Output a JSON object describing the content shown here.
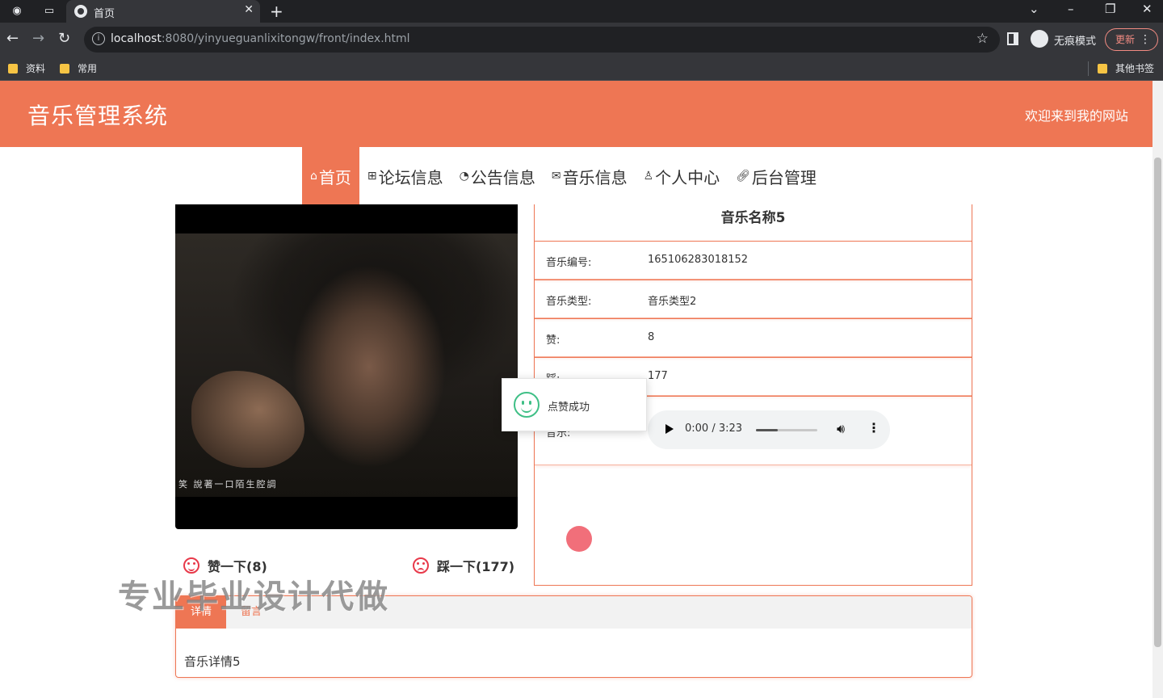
{
  "browser": {
    "tab_title": "首页",
    "url_host": "localhost",
    "url_path": ":8080/yinyueguanlixitongw/front/index.html",
    "profile_label": "无痕模式",
    "update_label": "更新",
    "bookmarks": [
      "资料",
      "常用"
    ],
    "other_bookmarks": "其他书签"
  },
  "header": {
    "title": "音乐管理系统",
    "welcome": "欢迎来到我的网站",
    "accent_color": "#ee7654"
  },
  "nav": {
    "items": [
      {
        "icon": "home-icon",
        "label": "首页"
      },
      {
        "icon": "gift-icon",
        "label": "论坛信息"
      },
      {
        "icon": "gauge-icon",
        "label": "公告信息"
      },
      {
        "icon": "mail-icon",
        "label": "音乐信息"
      },
      {
        "icon": "user-icon",
        "label": "个人中心"
      },
      {
        "icon": "link-icon",
        "label": "后台管理"
      }
    ],
    "active_index": 0
  },
  "media": {
    "subtitle": "笑 說著一口陌生腔調"
  },
  "votes": {
    "like_label": "赞一下(8)",
    "dislike_label": "踩一下(177)"
  },
  "music": {
    "name": "音乐名称5",
    "rows": [
      {
        "label": "音乐编号:",
        "value": "165106283018152"
      },
      {
        "label": "音乐类型:",
        "value": "音乐类型2"
      },
      {
        "label": "赞:",
        "value": "8"
      },
      {
        "label": "踩:",
        "value": "177"
      }
    ],
    "audio_label": "音乐:",
    "audio": {
      "time": "0:00 / 3:23",
      "volume_fraction": 0.35
    }
  },
  "toast": {
    "message": "点赞成功",
    "color": "#3fbf86"
  },
  "detail": {
    "tabs": [
      "详情",
      "留言"
    ],
    "active_tab": 0,
    "content": "音乐详情5"
  },
  "watermark": "专业毕业设计代做"
}
